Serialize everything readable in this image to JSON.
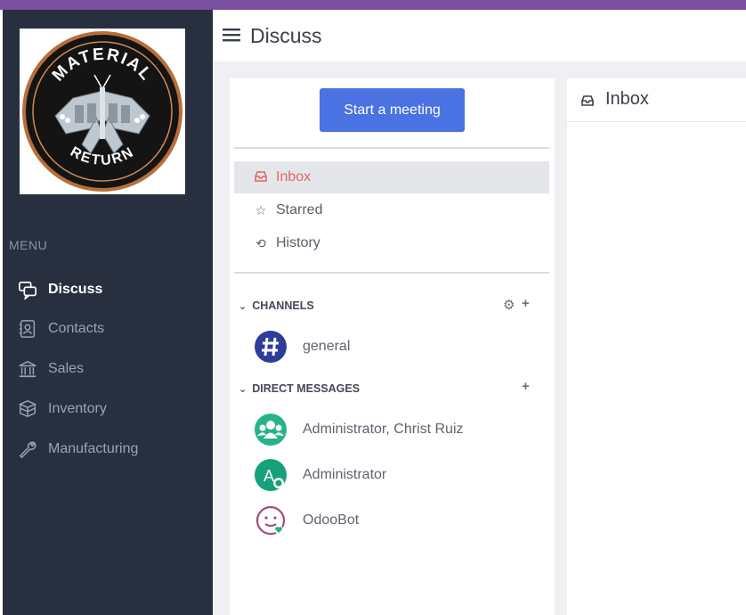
{
  "header": {
    "title": "Discuss"
  },
  "logo": {
    "top_text": "MATERIAL",
    "bottom_text": "RETURN"
  },
  "menu": {
    "title": "MENU",
    "items": [
      {
        "label": "Discuss",
        "icon": "chat-icon",
        "active": true
      },
      {
        "label": "Contacts",
        "icon": "contacts-icon"
      },
      {
        "label": "Sales",
        "icon": "bank-icon"
      },
      {
        "label": "Inventory",
        "icon": "boxes-icon"
      },
      {
        "label": "Manufacturing",
        "icon": "wrench-icon"
      }
    ]
  },
  "discuss": {
    "meeting_button": "Start a meeting",
    "mailboxes": [
      {
        "label": "Inbox",
        "icon": "inbox-icon",
        "active": true
      },
      {
        "label": "Starred",
        "icon": "star-icon"
      },
      {
        "label": "History",
        "icon": "history-icon"
      }
    ],
    "channels_title": "CHANNELS",
    "channels": [
      {
        "name": "general",
        "icon": "hash-icon"
      }
    ],
    "dm_title": "DIRECT MESSAGES",
    "direct_messages": [
      {
        "name": "Administrator, Christ Ruiz"
      },
      {
        "name": "Administrator"
      },
      {
        "name": "OdooBot"
      }
    ]
  },
  "main": {
    "title": "Inbox"
  },
  "colors": {
    "accent": "#4a72e2",
    "sidebar": "#283040",
    "topbar": "#7b4fa0",
    "active_mailbox": "#e06767"
  }
}
